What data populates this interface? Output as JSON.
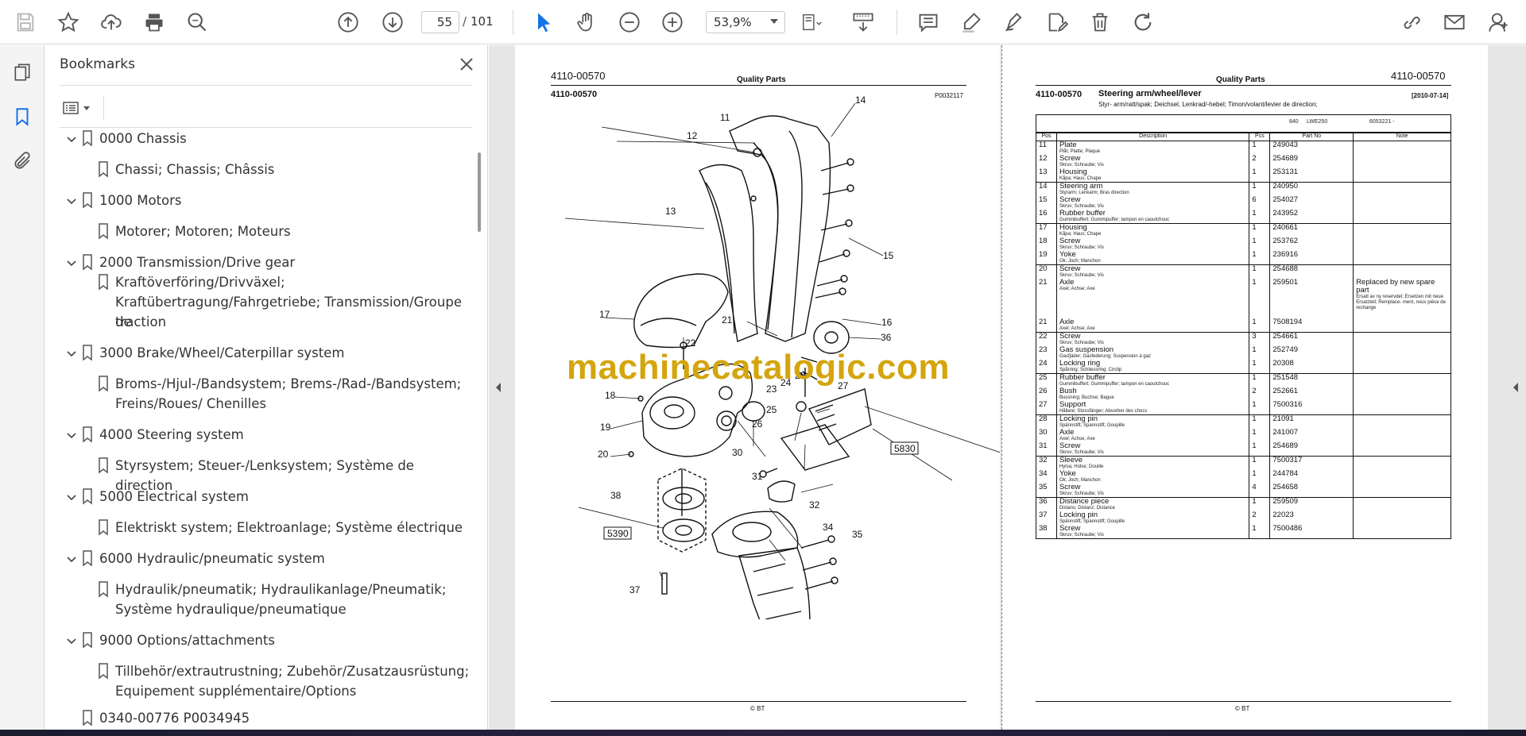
{
  "toolbar": {
    "page_current": "55",
    "page_separator": "/",
    "page_total": "101",
    "zoom": "53,9%"
  },
  "sidebar": {
    "title": "Bookmarks",
    "items": [
      {
        "label": "0000 Chassis",
        "level": 0
      },
      {
        "label": "Chassi; Chassis; Châssis",
        "level": 1
      },
      {
        "label": "1000 Motors",
        "level": 0
      },
      {
        "label": "Motorer; Motoren; Moteurs",
        "level": 1
      },
      {
        "label": "2000 Transmission/Drive gear",
        "level": 0
      },
      {
        "label": "Kraftöverföring/Drivväxel;",
        "level": 1
      },
      {
        "label": "Kraftübertragung/Fahrgetriebe; Transmission/Groupe de",
        "level": 1
      },
      {
        "label": "traction",
        "level": 1
      },
      {
        "label": "3000 Brake/Wheel/Caterpillar system",
        "level": 0
      },
      {
        "label": "Broms-/Hjul-/Bandsystem; Brems-/Rad-/Bandsystem;",
        "level": 1
      },
      {
        "label": "Freins/Roues/ Chenilles",
        "level": 1
      },
      {
        "label": "4000 Steering system",
        "level": 0
      },
      {
        "label": "Styrsystem; Steuer-/Lenksystem; Système de direction",
        "level": 1
      },
      {
        "label": "5000 Electrical system",
        "level": 0
      },
      {
        "label": "Elektriskt system; Elektroanlage; Système électrique",
        "level": 1
      },
      {
        "label": "6000 Hydraulic/pneumatic system",
        "level": 0
      },
      {
        "label": "Hydraulik/pneumatik; Hydraulikanlage/Pneumatik;",
        "level": 1
      },
      {
        "label": "Système hydraulique/pneumatique",
        "level": 1
      },
      {
        "label": "9000 Options/attachments",
        "level": 0
      },
      {
        "label": "Tillbehör/extrautrustning; Zubehör/Zusatzausrüstung;",
        "level": 1
      },
      {
        "label": "Equipement supplémentaire/Options",
        "level": 1
      },
      {
        "label": "0340-00776 P0034945",
        "level": 0
      }
    ]
  },
  "left_page": {
    "code_top": "4110-00570",
    "header": "Quality Parts",
    "code": "4110-00570",
    "drawing_no": "P0032117",
    "footer": "© BT",
    "callouts": [
      "11",
      "12",
      "13",
      "14",
      "15",
      "16",
      "17",
      "18",
      "19",
      "20",
      "21",
      "22",
      "23",
      "24",
      "25",
      "26",
      "27",
      "28",
      "30",
      "31",
      "32",
      "34",
      "35",
      "36",
      "37",
      "38"
    ],
    "boxed_refs": [
      "5830",
      "5390"
    ]
  },
  "watermark": "machinecatalogic.com",
  "right_page": {
    "code_top": "4110-00570",
    "header": "Quality Parts",
    "code": "4110-00570",
    "title": "Steering arm/wheel/lever",
    "date": "[2010-07-14]",
    "subtitle": "Styr- arm/ratt/spak; Deichsel, Lenkrad/-hebel; Timon/volant/levier de direction;",
    "config": {
      "model": "840",
      "variant": "LWE250",
      "serial": "6053221 -"
    },
    "columns": [
      "Pos",
      "Description",
      "Pcs",
      "Part No",
      "Note"
    ],
    "footer": "© BT",
    "rows": [
      {
        "pos": "11",
        "desc": "Plate",
        "sub": "Plåt; Platte; Plaque",
        "pcs": "1",
        "part": "249043",
        "note": ""
      },
      {
        "pos": "12",
        "desc": "Screw",
        "sub": "Skruv; Schraube; Vis",
        "pcs": "2",
        "part": "254689",
        "note": ""
      },
      {
        "pos": "13",
        "desc": "Housing",
        "sub": "Kåpa; Haus; Chape",
        "pcs": "1",
        "part": "253131",
        "note": "",
        "gb": true
      },
      {
        "pos": "14",
        "desc": "Steering arm",
        "sub": "Styrarm; Lenkarm; Bras direction",
        "pcs": "1",
        "part": "240950",
        "note": ""
      },
      {
        "pos": "15",
        "desc": "Screw",
        "sub": "Skruv; Schraube; Vis",
        "pcs": "6",
        "part": "254027",
        "note": ""
      },
      {
        "pos": "16",
        "desc": "Rubber buffer",
        "sub": "Gummibuffert; Gummipuffer; tampon en caoutchouc",
        "pcs": "1",
        "part": "243952",
        "note": "",
        "gb": true
      },
      {
        "pos": "17",
        "desc": "Housing",
        "sub": "Kåpa; Haus; Chape",
        "pcs": "1",
        "part": "240661",
        "note": ""
      },
      {
        "pos": "18",
        "desc": "Screw",
        "sub": "Skruv; Schraube; Vis",
        "pcs": "1",
        "part": "253762",
        "note": ""
      },
      {
        "pos": "19",
        "desc": "Yoke",
        "sub": "Ok; Joch; Manchon",
        "pcs": "1",
        "part": "236916",
        "note": "",
        "gb": true
      },
      {
        "pos": "20",
        "desc": "Screw",
        "sub": "Skruv; Schraube; Vis",
        "pcs": "1",
        "part": "254688",
        "note": ""
      },
      {
        "pos": "21",
        "desc": "Axle",
        "sub": "Axel; Achse; Axe",
        "pcs": "1",
        "part": "259501",
        "note": "Replaced by new spare part",
        "note_sub": "Ersatt av ny reservdel; Ersetzen mit neue Ersatzteil; Remplace- ment, nouv pièce de rechange"
      },
      {
        "pos": "21",
        "desc": "Axle",
        "sub": "Axel; Achse; Axe",
        "pcs": "1",
        "part": "7508194",
        "note": "",
        "gb": true
      },
      {
        "pos": "22",
        "desc": "Screw",
        "sub": "Skruv; Schraube; Vis",
        "pcs": "3",
        "part": "254661",
        "note": ""
      },
      {
        "pos": "23",
        "desc": "Gas suspension",
        "sub": "Gasfjäder; Gasfederung; Suspension à gaz",
        "pcs": "1",
        "part": "252749",
        "note": ""
      },
      {
        "pos": "24",
        "desc": "Locking ring",
        "sub": "Spårring; Schliessring; Circlip",
        "pcs": "1",
        "part": "20308",
        "note": "",
        "gb": true
      },
      {
        "pos": "25",
        "desc": "Rubber buffer",
        "sub": "Gummibuffert; Gummipuffer; tampon en caoutchouc",
        "pcs": "1",
        "part": "251548",
        "note": ""
      },
      {
        "pos": "26",
        "desc": "Bush",
        "sub": "Bussning; Buchse; Bague",
        "pcs": "2",
        "part": "252661",
        "note": ""
      },
      {
        "pos": "27",
        "desc": "Support",
        "sub": "Hållare; Stossfänger; Absorber des chocs",
        "pcs": "1",
        "part": "7500316",
        "note": "",
        "gb": true
      },
      {
        "pos": "28",
        "desc": "Locking pin",
        "sub": "Spännstift; Spannstift; Goupille",
        "pcs": "1",
        "part": "21091",
        "note": ""
      },
      {
        "pos": "30",
        "desc": "Axle",
        "sub": "Axel; Achse; Axe",
        "pcs": "1",
        "part": "241007",
        "note": ""
      },
      {
        "pos": "31",
        "desc": "Screw",
        "sub": "Skruv; Schraube; Vis",
        "pcs": "1",
        "part": "254689",
        "note": "",
        "gb": true
      },
      {
        "pos": "32",
        "desc": "Sleeve",
        "sub": "Hylsa; Hülse; Douille",
        "pcs": "1",
        "part": "7500317",
        "note": ""
      },
      {
        "pos": "34",
        "desc": "Yoke",
        "sub": "Ok; Joch; Manchon",
        "pcs": "1",
        "part": "244784",
        "note": ""
      },
      {
        "pos": "35",
        "desc": "Screw",
        "sub": "Skruv; Schraube; Vis",
        "pcs": "4",
        "part": "254658",
        "note": "",
        "gb": true
      },
      {
        "pos": "36",
        "desc": "Distance piece",
        "sub": "Distans; Distanz; Distance",
        "pcs": "1",
        "part": "259509",
        "note": ""
      },
      {
        "pos": "37",
        "desc": "Locking pin",
        "sub": "Spännstift; Spannstift; Goupille",
        "pcs": "2",
        "part": "22023",
        "note": ""
      },
      {
        "pos": "38",
        "desc": "Screw",
        "sub": "Skruv; Schraube; Vis",
        "pcs": "1",
        "part": "7500486",
        "note": "",
        "gb": true
      }
    ]
  }
}
